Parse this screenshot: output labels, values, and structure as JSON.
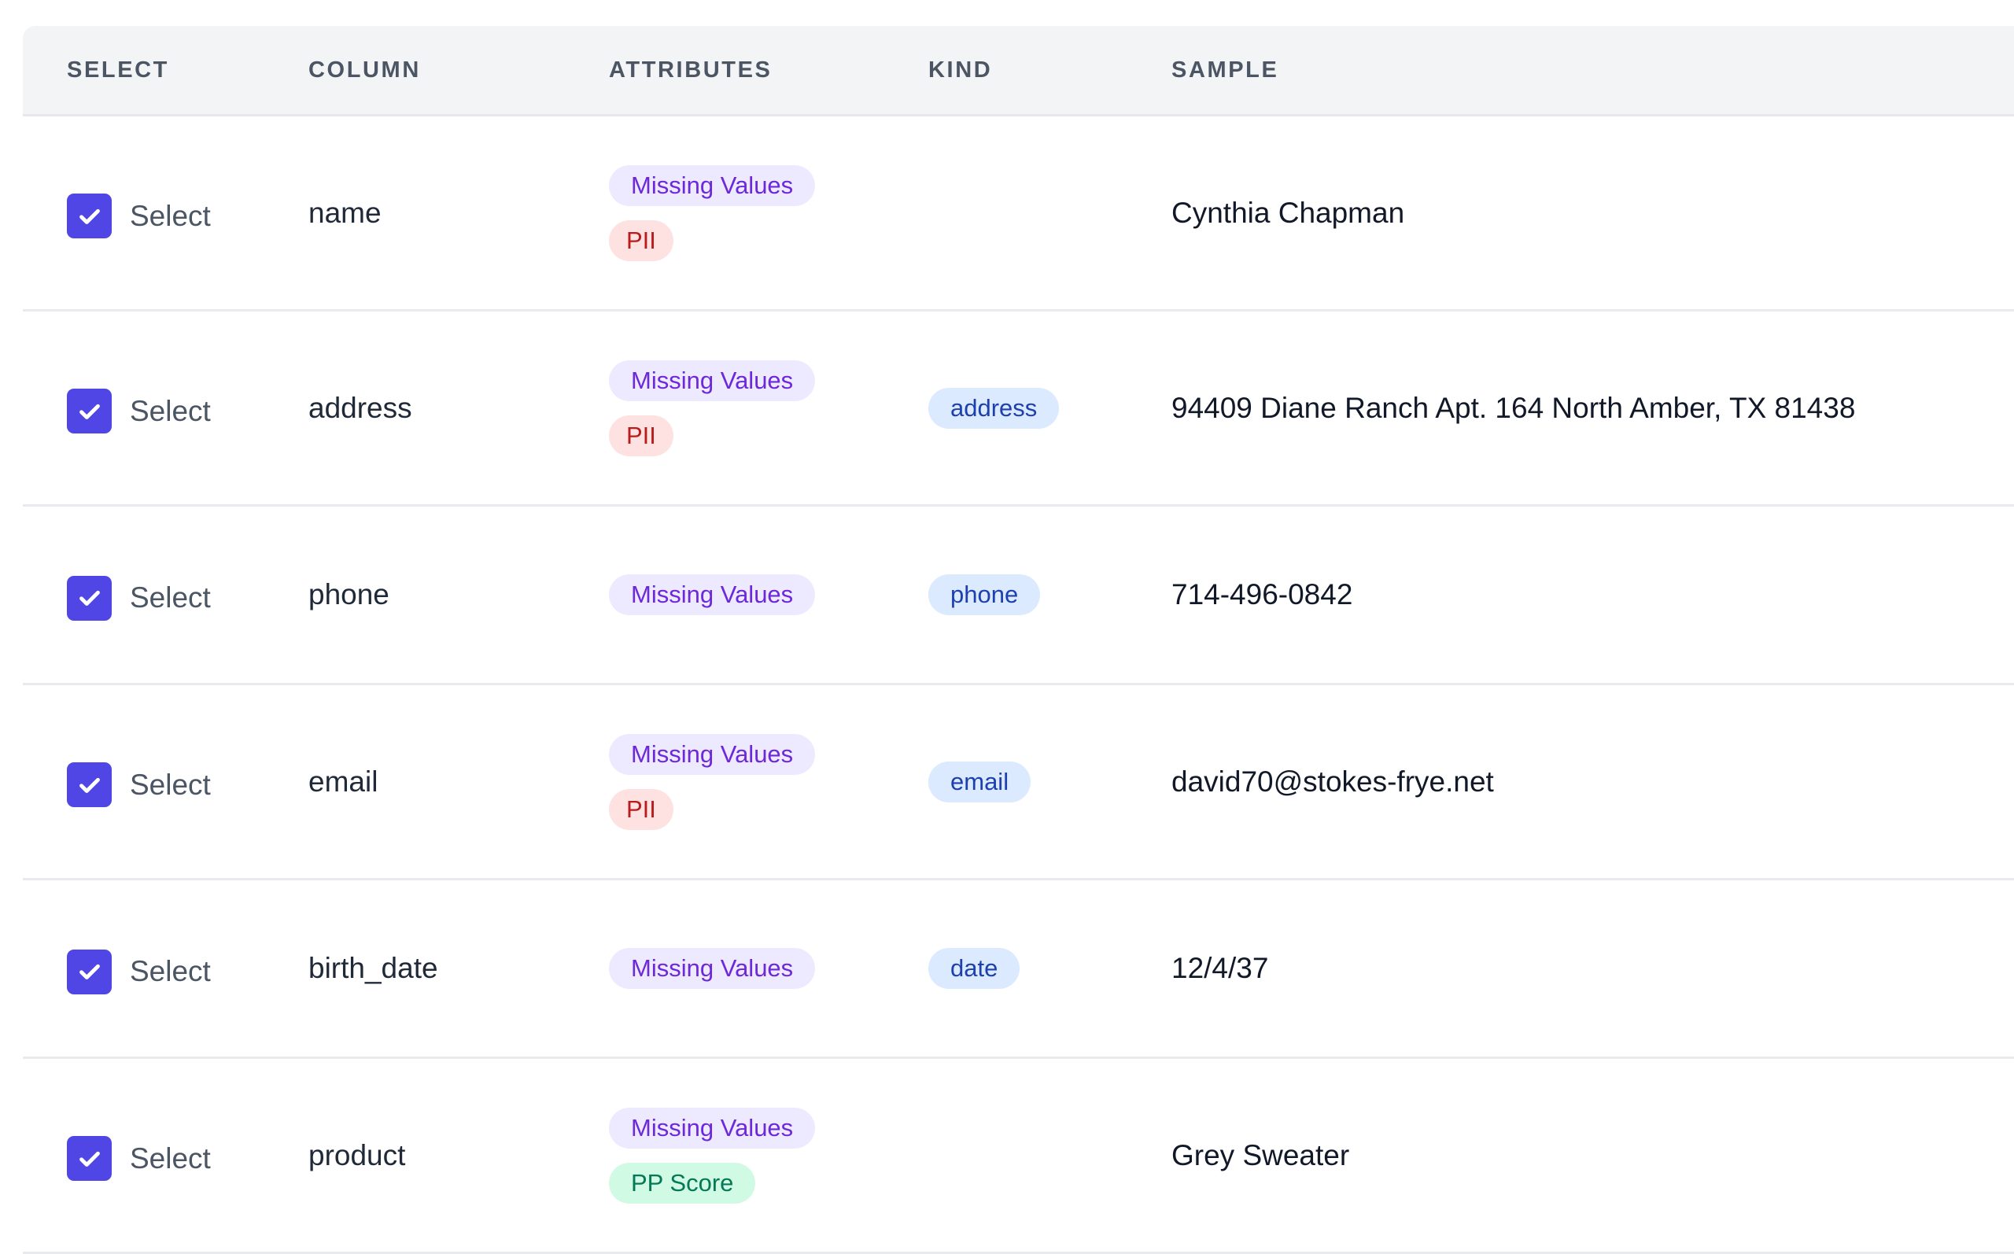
{
  "header": {
    "select": "SELECT",
    "column": "COLUMN",
    "attributes": "ATTRIBUTES",
    "kind": "KIND",
    "sample": "SAMPLE"
  },
  "colors": {
    "checkbox": "#4f46e5",
    "missing_values_badge_bg": "#ede9fe",
    "missing_values_badge_text": "#6d28d9",
    "pii_badge_bg": "#fee2e2",
    "pii_badge_text": "#b91c1c",
    "pp_score_badge_bg": "#d1fae5",
    "pp_score_badge_text": "#047857",
    "kind_badge_bg": "#dbeafe",
    "kind_badge_text": "#1e40af"
  },
  "rows": [
    {
      "checked": true,
      "select_label": "Select",
      "column": "name",
      "attributes": [
        "Missing Values",
        "PII"
      ],
      "kind": "",
      "sample": "Cynthia Chapman"
    },
    {
      "checked": true,
      "select_label": "Select",
      "column": "address",
      "attributes": [
        "Missing Values",
        "PII"
      ],
      "kind": "address",
      "sample": "94409 Diane Ranch Apt. 164 North Amber, TX 81438"
    },
    {
      "checked": true,
      "select_label": "Select",
      "column": "phone",
      "attributes": [
        "Missing Values"
      ],
      "kind": "phone",
      "sample": "714-496-0842"
    },
    {
      "checked": true,
      "select_label": "Select",
      "column": "email",
      "attributes": [
        "Missing Values",
        "PII"
      ],
      "kind": "email",
      "sample": "david70@stokes-frye.net"
    },
    {
      "checked": true,
      "select_label": "Select",
      "column": "birth_date",
      "attributes": [
        "Missing Values"
      ],
      "kind": "date",
      "sample": "12/4/37"
    },
    {
      "checked": true,
      "select_label": "Select",
      "column": "product",
      "attributes": [
        "Missing Values",
        "PP Score"
      ],
      "kind": "",
      "sample": "Grey Sweater"
    }
  ]
}
